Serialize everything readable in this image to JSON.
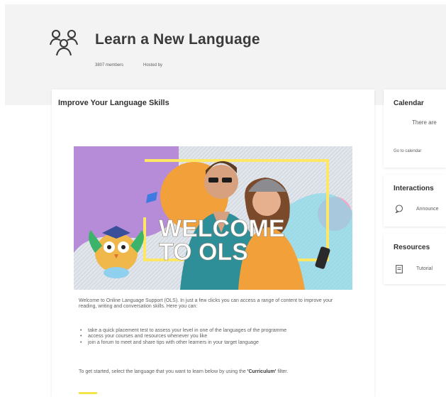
{
  "group": {
    "title": "Learn a New Language",
    "members": "3807 members",
    "hosted": "Hosted by"
  },
  "main": {
    "title": "Improve Your Language Skills",
    "banner_text": [
      "WELCOME",
      "TO OLS"
    ],
    "intro": "Welcome to Online Language Support (OLS). In just a few clicks you can access a range of content to improve your reading, writing and conversation skills. Here you can:",
    "bullets": [
      "take a quick placement test to assess your level in one of the languages of the programme",
      "access your courses and resources whenever you like",
      "join a forum to meet and share tips with other learners in your target language"
    ],
    "outro_prefix": "To get started, select the language that you want to learn below by using the",
    "outro_bold": "'Curriculum'",
    "outro_suffix": "filter."
  },
  "sidebar": {
    "calendar": {
      "title": "Calendar",
      "text": "There are",
      "link": "Go to calendar"
    },
    "interactions": {
      "title": "Interactions",
      "item": "Announce"
    },
    "resources": {
      "title": "Resources",
      "item": "Tutorial"
    }
  },
  "icons": {
    "group": "group-people-icon",
    "announcement": "chat-bubble-icon",
    "resource": "document-icon"
  },
  "colors": {
    "header_bg": "#f3f3f3",
    "banner_purple": "#b68bd8",
    "banner_orange": "#f2a13a",
    "banner_cyan": "#7fd8e8",
    "neon_frame": "#ffe766",
    "link_highlight": "#f2e44a"
  }
}
